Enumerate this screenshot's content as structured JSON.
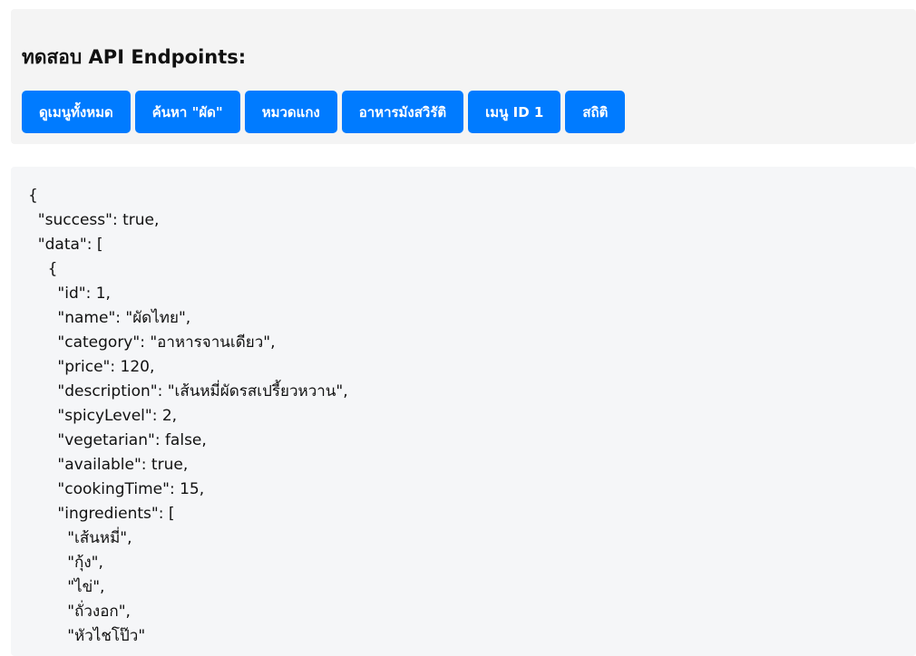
{
  "panel": {
    "title": "ทดสอบ API Endpoints:",
    "buttons": [
      {
        "label": "ดูเมนูทั้งหมด"
      },
      {
        "label": "ค้นหา \"ผัด\""
      },
      {
        "label": "หมวดแกง"
      },
      {
        "label": "อาหารมังสวิรัติ"
      },
      {
        "label": "เมนู ID 1"
      },
      {
        "label": "สถิติ"
      }
    ]
  },
  "output": {
    "lines": [
      "{",
      "  \"success\": true,",
      "  \"data\": [",
      "    {",
      "      \"id\": 1,",
      "      \"name\": \"ผัดไทย\",",
      "      \"category\": \"อาหารจานเดียว\",",
      "      \"price\": 120,",
      "      \"description\": \"เส้นหมี่ผัดรสเปรี้ยวหวาน\",",
      "      \"spicyLevel\": 2,",
      "      \"vegetarian\": false,",
      "      \"available\": true,",
      "      \"cookingTime\": 15,",
      "      \"ingredients\": [",
      "        \"เส้นหมี่\",",
      "        \"กุ้ง\",",
      "        \"ไข่\",",
      "        \"ถั่วงอก\",",
      "        \"หัวไชโป๊ว\""
    ]
  }
}
